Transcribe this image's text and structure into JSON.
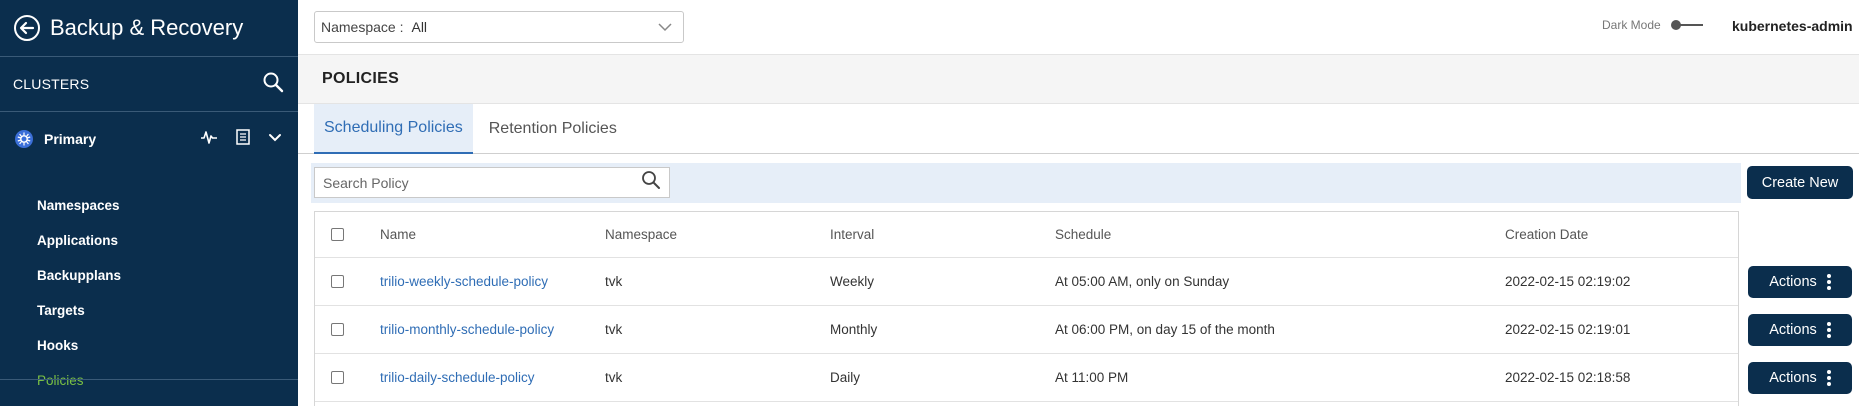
{
  "app": {
    "title": "Backup & Recovery"
  },
  "sidebar": {
    "clusters_label": "CLUSTERS",
    "cluster_name": "Primary",
    "items": [
      {
        "label": "Namespaces",
        "active": false
      },
      {
        "label": "Applications",
        "active": false
      },
      {
        "label": "Backupplans",
        "active": false
      },
      {
        "label": "Targets",
        "active": false
      },
      {
        "label": "Hooks",
        "active": false
      },
      {
        "label": "Policies",
        "active": true
      }
    ]
  },
  "topbar": {
    "namespace_label": "Namespace :",
    "namespace_value": "All",
    "dark_mode_label": "Dark Mode",
    "username": "kubernetes-admin"
  },
  "page": {
    "title": "POLICIES"
  },
  "tabs": [
    {
      "label": "Scheduling Policies",
      "active": true
    },
    {
      "label": "Retention Policies",
      "active": false
    }
  ],
  "search": {
    "placeholder": "Search Policy"
  },
  "create_button": "Create New",
  "table": {
    "columns": [
      "Name",
      "Namespace",
      "Interval",
      "Schedule",
      "Creation Date"
    ],
    "rows": [
      {
        "name": "trilio-weekly-schedule-policy",
        "namespace": "tvk",
        "interval": "Weekly",
        "schedule": "At 05:00 AM, only on Sunday",
        "created": "2022-02-15 02:19:02"
      },
      {
        "name": "trilio-monthly-schedule-policy",
        "namespace": "tvk",
        "interval": "Monthly",
        "schedule": "At 06:00 PM, on day 15 of the month",
        "created": "2022-02-15 02:19:01"
      },
      {
        "name": "trilio-daily-schedule-policy",
        "namespace": "tvk",
        "interval": "Daily",
        "schedule": "At 11:00 PM",
        "created": "2022-02-15 02:18:58"
      }
    ],
    "actions_label": "Actions"
  },
  "colors": {
    "sidebar_bg": "#0b2e4d",
    "accent": "#2f6db5",
    "active_nav": "#7bc143"
  }
}
